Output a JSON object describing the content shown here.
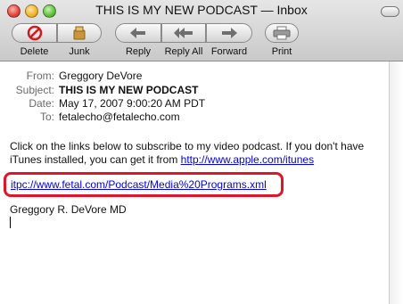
{
  "window": {
    "title": "THIS IS MY NEW PODCAST — Inbox"
  },
  "toolbar": {
    "delete_label": "Delete",
    "junk_label": "Junk",
    "reply_label": "Reply",
    "reply_all_label": "Reply All",
    "forward_label": "Forward",
    "print_label": "Print"
  },
  "headers": {
    "from_key": "From:",
    "from_value": "Greggory DeVore",
    "subject_key": "Subject:",
    "subject_value": "THIS IS MY NEW PODCAST",
    "date_key": "Date:",
    "date_value": "May 17, 2007 9:00:20 AM PDT",
    "to_key": "To:",
    "to_value": "fetalecho@fetalecho.com"
  },
  "body": {
    "intro_text": "Click on the links below to subscribe to my video podcast.  If you don't have iTunes installed, you can get it from ",
    "apple_link": "http://www.apple.com/itunes",
    "podcast_link": "itpc://www.fetal.com/Podcast/Media%20Programs.xml",
    "signature": "Greggory R. DeVore MD"
  },
  "colors": {
    "link": "#0000ee",
    "highlight_border": "#e0152a"
  }
}
